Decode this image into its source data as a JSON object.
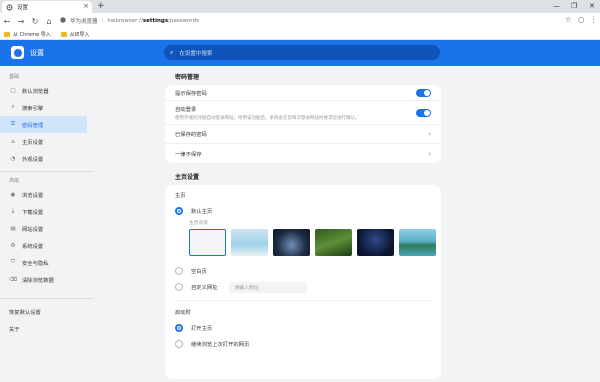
{
  "tab": {
    "title": "设置",
    "close": "×",
    "newtab": "+"
  },
  "window": {
    "minimize": "—",
    "restore": "❐",
    "close": "✕"
  },
  "toolbar": {
    "back": "←",
    "forward": "→",
    "reload": "↻",
    "home": "⌂",
    "brand": "华为浏览器",
    "url_prefix": "hwbrowser://",
    "url_bold": "settings",
    "url_suffix": "/passwords",
    "star": "☆",
    "menu": "⋮",
    "account": "○"
  },
  "bookmarks": [
    {
      "label": "从 Chrome 导入"
    },
    {
      "label": "从IE导入"
    }
  ],
  "header": {
    "title": "设置",
    "search_placeholder": "在设置中搜索"
  },
  "sidebar": {
    "group1": "基础",
    "items1": [
      {
        "label": "默认浏览器",
        "icon": "□"
      },
      {
        "label": "搜索引擎",
        "icon": "⌕"
      },
      {
        "label": "密码管理",
        "icon": "⚿"
      },
      {
        "label": "主页设置",
        "icon": "⌂"
      },
      {
        "label": "外观设置",
        "icon": "◔"
      }
    ],
    "group2": "高级",
    "items2": [
      {
        "label": "浏览设置",
        "icon": "◉"
      },
      {
        "label": "下载设置",
        "icon": "⤓"
      },
      {
        "label": "网站设置",
        "icon": "▤"
      },
      {
        "label": "系统设置",
        "icon": "⚙"
      },
      {
        "label": "安全与隐私",
        "icon": "⛉"
      },
      {
        "label": "清除浏览数据",
        "icon": "⌫"
      }
    ],
    "footer": [
      {
        "label": "恢复默认设置"
      },
      {
        "label": "关于"
      }
    ]
  },
  "password": {
    "title": "密码管理",
    "offer_save": "提示保存密码",
    "auto_login": "自动登录",
    "auto_login_desc": "使用存储的凭据自动登录网站。停用该功能后，系统会在您每次登录网站时要求您进行确认。",
    "saved": "已保存的密码",
    "never": "一律不保存",
    "chevron": "›"
  },
  "homepage": {
    "title": "主页设置",
    "home_label": "主页",
    "default_home": "默认主页",
    "bg_label": "主页背景",
    "blank": "空白页",
    "custom": "自定义网址",
    "custom_placeholder": "请输入网址",
    "startup_label": "启动时",
    "open_home": "打开主页",
    "continue": "继续浏览上次打开的网页"
  }
}
